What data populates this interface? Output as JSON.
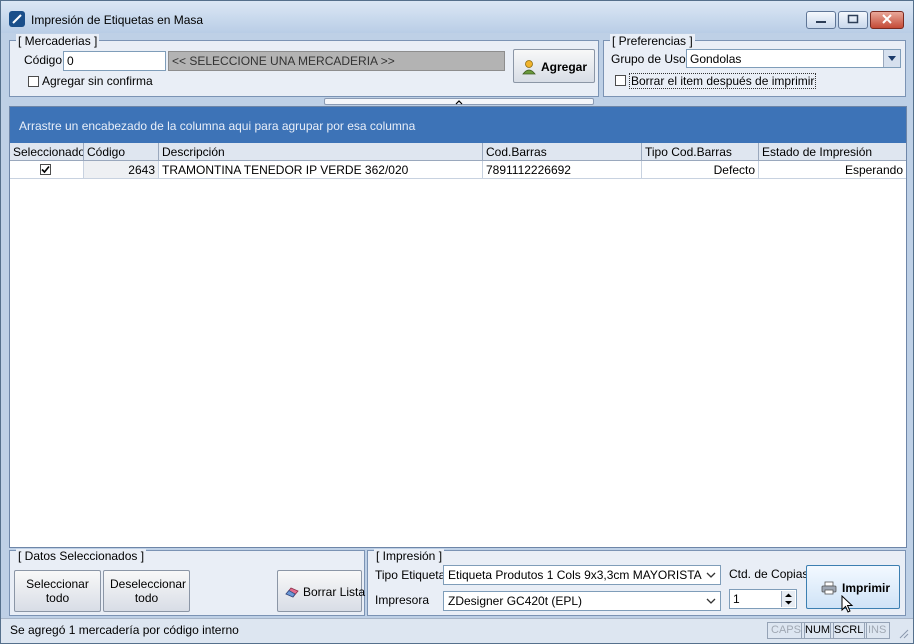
{
  "window": {
    "title": "Impresión de Etiquetas en Masa"
  },
  "mercaderias": {
    "legend": "[ Mercaderias ]",
    "codigo_label": "Código",
    "codigo_value": "0",
    "selector_text": "<< SELECCIONE UNA MERCADERIA >>",
    "agregar_sin_confirma_label": "Agregar sin confirma",
    "agregar_sin_confirma_checked": false,
    "agregar_button": "Agregar"
  },
  "preferencias": {
    "legend": "[ Preferencias ]",
    "grupo_uso_label": "Grupo de Uso",
    "grupo_uso_value": "Gondolas",
    "borrar_label": "Borrar el item después de imprimir",
    "borrar_checked": false
  },
  "grid": {
    "group_hint": "Arrastre un encabezado de la columna aqui para agrupar por esa columna",
    "columns": [
      "Seleccionado",
      "Código",
      "Descripción",
      "Cod.Barras",
      "Tipo Cod.Barras",
      "Estado de Impresión"
    ],
    "rows": [
      {
        "selected": true,
        "codigo": "2643",
        "descripcion": "TRAMONTINA TENEDOR IP VERDE 362/020",
        "cod_barras": "7891112226692",
        "tipo_cod_barras": "Defecto",
        "estado": "Esperando"
      }
    ]
  },
  "datos_seleccionados": {
    "legend": "[ Datos Seleccionados ]",
    "seleccionar_todo": "Seleccionar todo",
    "deseleccionar_todo": "Deseleccionar todo",
    "borrar_lista": "Borrar Lista"
  },
  "impresion": {
    "legend": "[ Impresión ]",
    "tipo_etiqueta_label": "Tipo Etiqueta",
    "tipo_etiqueta_value": "Etiqueta Produtos 1 Cols 9x3,3cm MAYORISTA",
    "impresora_label": "Impresora",
    "impresora_value": "ZDesigner GC420t (EPL)",
    "copias_label": "Ctd. de Copias",
    "copias_value": "1",
    "imprimir_button": "Imprimir"
  },
  "statusbar": {
    "message": "Se agregó 1 mercadería por código interno",
    "indicators": [
      {
        "label": "CAPS",
        "active": false
      },
      {
        "label": "NUM",
        "active": true
      },
      {
        "label": "SCRL",
        "active": true
      },
      {
        "label": "INS",
        "active": false
      }
    ]
  },
  "colors": {
    "group_bar": "#3d73b7",
    "window_bg": "#bed0e6",
    "panel_bg": "#e9eef6"
  }
}
